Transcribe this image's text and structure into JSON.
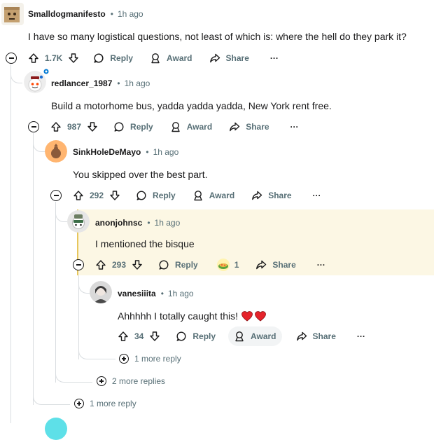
{
  "colors": {
    "highlight_bg": "#fcf7e4",
    "highlight_border": "#e7c65c",
    "heart": "#e5232b",
    "meta_text": "#576f76"
  },
  "comments": [
    {
      "username": "Smalldogmanifesto",
      "time": "1h ago",
      "body": "I have so many logistical questions, not least of which is: where the hell do they park it?",
      "votes": "1.7K",
      "reply": "Reply",
      "award": "Award",
      "share": "Share",
      "more": "···"
    },
    {
      "username": "redlancer_1987",
      "time": "1h ago",
      "body": "Build a motorhome bus, yadda yadda yadda, New York rent free.",
      "votes": "987",
      "reply": "Reply",
      "award": "Award",
      "share": "Share",
      "more": "···"
    },
    {
      "username": "SinkHoleDeMayo",
      "time": "1h ago",
      "body": "You skipped over the best part.",
      "votes": "292",
      "reply": "Reply",
      "award": "Award",
      "share": "Share",
      "more": "···"
    },
    {
      "username": "anonjohnsc",
      "time": "1h ago",
      "body": "I mentioned the bisque",
      "votes": "293",
      "reply": "Reply",
      "award_count": "1",
      "share": "Share",
      "more": "···"
    },
    {
      "username": "vanesiiita",
      "time": "1h ago",
      "body": "Ahhhhh I totally caught this!",
      "votes": "34",
      "reply": "Reply",
      "award": "Award",
      "share": "Share",
      "more": "···"
    }
  ],
  "more_replies": {
    "vanesiiita": "1 more reply",
    "anonjohnsc": "2 more replies",
    "redlancer": "1 more reply"
  },
  "separator": "•"
}
